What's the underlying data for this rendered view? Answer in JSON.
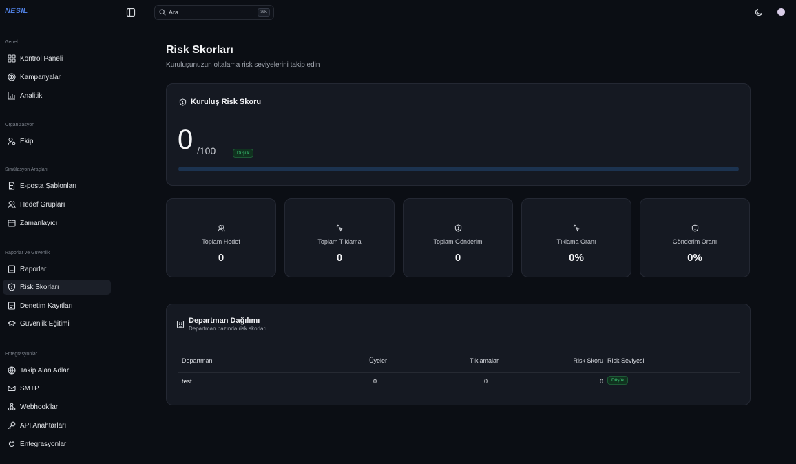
{
  "app": {
    "logo": "NESIL"
  },
  "search": {
    "placeholder": "Ara",
    "shortcut": "⌘K"
  },
  "sidebar": {
    "sections": [
      {
        "label": "Genel",
        "items": [
          {
            "label": "Kontrol Paneli",
            "icon": "dashboard-icon"
          },
          {
            "label": "Kampanyalar",
            "icon": "target-icon"
          },
          {
            "label": "Analitik",
            "icon": "bar-chart-icon"
          }
        ]
      },
      {
        "label": "Organizasyon",
        "items": [
          {
            "label": "Ekip",
            "icon": "user-icon"
          }
        ]
      },
      {
        "label": "Simülasyon Araçları",
        "items": [
          {
            "label": "E-posta Şablonları",
            "icon": "file-text-icon"
          },
          {
            "label": "Hedef Grupları",
            "icon": "users-icon"
          },
          {
            "label": "Zamanlayıcı",
            "icon": "calendar-icon"
          }
        ]
      },
      {
        "label": "Raporlar ve Güvenlik",
        "items": [
          {
            "label": "Raporlar",
            "icon": "report-icon"
          },
          {
            "label": "Risk Skorları",
            "icon": "shield-icon",
            "active": true
          },
          {
            "label": "Denetim Kayıtları",
            "icon": "log-icon"
          },
          {
            "label": "Güvenlik Eğitimi",
            "icon": "graduation-cap-icon"
          }
        ]
      },
      {
        "label": "Entegrasyonlar",
        "items": [
          {
            "label": "Takip Alan Adları",
            "icon": "globe-icon"
          },
          {
            "label": "SMTP",
            "icon": "mail-icon"
          },
          {
            "label": "Webhook'lar",
            "icon": "webhook-icon"
          },
          {
            "label": "API Anahtarları",
            "icon": "key-icon"
          },
          {
            "label": "Entegrasyonlar",
            "icon": "plug-icon"
          }
        ]
      }
    ]
  },
  "page": {
    "title": "Risk Skorları",
    "subtitle": "Kuruluşunuzun oltalama risk seviyelerini takip edin"
  },
  "org_score": {
    "title": "Kuruluş Risk Skoru",
    "value": "0",
    "max": "/100",
    "level": "Düşük",
    "progress_fraction": 0.0
  },
  "stats": [
    {
      "label": "Toplam Hedef",
      "value": "0",
      "icon": "users-icon"
    },
    {
      "label": "Toplam Tıklama",
      "value": "0",
      "icon": "pointer-click-icon"
    },
    {
      "label": "Toplam Gönderim",
      "value": "0",
      "icon": "shield-icon"
    },
    {
      "label": "Tıklama Oranı",
      "value": "0%",
      "icon": "pointer-click-icon"
    },
    {
      "label": "Gönderim Oranı",
      "value": "0%",
      "icon": "shield-icon"
    }
  ],
  "departments": {
    "title": "Departman Dağılımı",
    "subtitle": "Departman bazında risk skorları",
    "columns": {
      "name": "Departman",
      "members": "Üyeler",
      "clicks": "Tıklamalar",
      "score": "Risk Skoru",
      "level": "Risk Seviyesi"
    },
    "rows": [
      {
        "name": "test",
        "members": "0",
        "clicks": "0",
        "score": "0",
        "level": "Düşük"
      }
    ]
  },
  "colors": {
    "background": "#0b0e14",
    "card": "#151922",
    "accent": "#3d7fe0",
    "low_badge": "#3fce7b"
  }
}
